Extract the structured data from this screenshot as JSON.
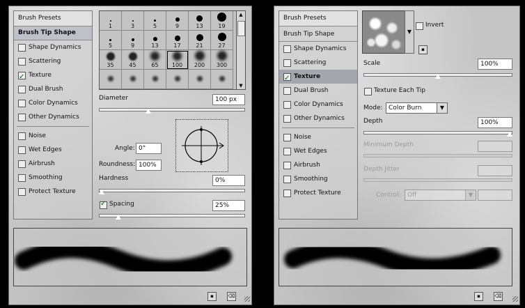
{
  "left": {
    "sidebar": {
      "presets": "Brush Presets",
      "tip": "Brush Tip Shape",
      "items": [
        {
          "label": "Shape Dynamics",
          "checked": false
        },
        {
          "label": "Scattering",
          "checked": false
        },
        {
          "label": "Texture",
          "checked": true
        },
        {
          "label": "Dual Brush",
          "checked": false
        },
        {
          "label": "Color Dynamics",
          "checked": false
        },
        {
          "label": "Other Dynamics",
          "checked": false
        },
        {
          "label": "Noise",
          "checked": false
        },
        {
          "label": "Wet Edges",
          "checked": false
        },
        {
          "label": "Airbrush",
          "checked": false
        },
        {
          "label": "Smoothing",
          "checked": false
        },
        {
          "label": "Protect Texture",
          "checked": false
        }
      ]
    },
    "tips": [
      "1",
      "3",
      "5",
      "9",
      "13",
      "19",
      "5",
      "9",
      "13",
      "17",
      "21",
      "27",
      "35",
      "45",
      "65",
      "100",
      "200",
      "300"
    ],
    "diameter": {
      "label": "Diameter",
      "value": "100 px",
      "level": 0.33
    },
    "angle": {
      "label": "Angle:",
      "value": "0°"
    },
    "roundness": {
      "label": "Roundness:",
      "value": "100%"
    },
    "hardness": {
      "label": "Hardness",
      "value": "0%",
      "level": 0.0
    },
    "spacing": {
      "label": "Spacing",
      "value": "25%",
      "checked": true,
      "level": 0.12
    }
  },
  "right": {
    "sidebar": {
      "presets": "Brush Presets",
      "tip": "Brush Tip Shape",
      "items": [
        {
          "label": "Shape Dynamics",
          "checked": false
        },
        {
          "label": "Scattering",
          "checked": false
        },
        {
          "label": "Texture",
          "checked": true
        },
        {
          "label": "Dual Brush",
          "checked": false
        },
        {
          "label": "Color Dynamics",
          "checked": false
        },
        {
          "label": "Other Dynamics",
          "checked": false
        },
        {
          "label": "Noise",
          "checked": false
        },
        {
          "label": "Wet Edges",
          "checked": false
        },
        {
          "label": "Airbrush",
          "checked": false
        },
        {
          "label": "Smoothing",
          "checked": false
        },
        {
          "label": "Protect Texture",
          "checked": false
        }
      ]
    },
    "invert": {
      "label": "Invert",
      "checked": false
    },
    "scale": {
      "label": "Scale",
      "value": "100%",
      "level": 0.5
    },
    "texture_each_tip": {
      "label": "Texture Each Tip",
      "checked": false
    },
    "mode": {
      "label": "Mode:",
      "value": "Color Burn"
    },
    "depth": {
      "label": "Depth",
      "value": "100%",
      "level": 1.0
    },
    "min_depth": {
      "label": "Minimum Depth",
      "value": ""
    },
    "depth_jitter": {
      "label": "Depth Jitter",
      "value": ""
    },
    "control": {
      "label": "Control:",
      "value": "Off"
    }
  }
}
